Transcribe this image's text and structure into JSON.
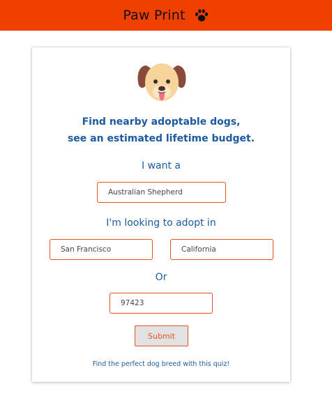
{
  "header": {
    "title": "Paw Print",
    "icon": "paw-icon",
    "background_color": "#f04000"
  },
  "card": {
    "illustration": "dog-face-icon",
    "headline_line1": "Find nearby adoptable dogs,",
    "headline_line2": "see an estimated lifetime budget.",
    "breed_label": "I want a",
    "breed_value": "Australian Shepherd",
    "location_label": "I'm looking to adopt in",
    "city_value": "San Francisco",
    "state_value": "California",
    "or_label": "Or",
    "zip_value": "97423",
    "submit_label": "Submit",
    "quiz_link": "Find the perfect dog breed with this quiz!",
    "accent_color": "#e8501c",
    "text_color": "#1d5aa0"
  }
}
